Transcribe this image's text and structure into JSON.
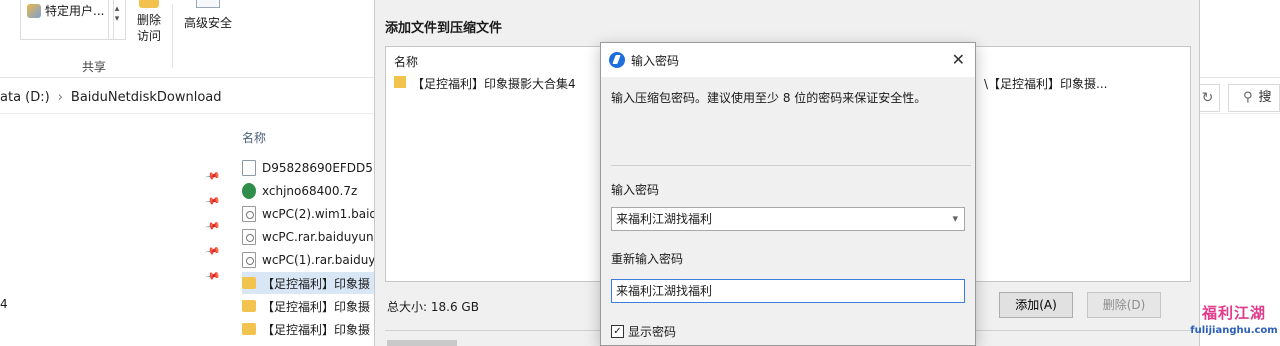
{
  "ribbon": {
    "share_dropdown": "特定用户...",
    "delete_access": [
      "删除",
      "访问"
    ],
    "advanced_security": "高级安全",
    "group_label": "共享"
  },
  "address": {
    "path": [
      "ata (D:)",
      "BaiduNetdiskDownload"
    ],
    "search_char": "搜"
  },
  "filelist": {
    "column_name": "名称",
    "items": [
      {
        "name": "D95828690EFDD5",
        "icon": "doc-icon"
      },
      {
        "name": "xchjno68400.7z",
        "icon": "7z-icon"
      },
      {
        "name": "wcPC(2).wim1.baid",
        "icon": "rar-icon"
      },
      {
        "name": "wcPC.rar.baiduyun",
        "icon": "rar-icon"
      },
      {
        "name": "wcPC(1).rar.baiduy",
        "icon": "rar-icon"
      },
      {
        "name": "【足控福利】印象摄",
        "icon": "folder-icon"
      },
      {
        "name": "【足控福利】印象摄",
        "icon": "folder-icon"
      },
      {
        "name": "【足控福利】印象摄",
        "icon": "folder-icon"
      }
    ],
    "left_fragment": "4"
  },
  "dialog": {
    "title": "添加文件到压缩文件",
    "list_header": "名称",
    "list_row": "【足控福利】印象摄影大合集4",
    "list_row_right": "\\【足控福利】印象摄...",
    "total_size": "总大小: 18.6 GB",
    "add_button": "添加(A)",
    "remove_button": "删除(D)"
  },
  "password_dialog": {
    "title": "输入密码",
    "description": "输入压缩包密码。建议使用至少 8 位的密码来保证安全性。",
    "label_password": "输入密码",
    "password_value": "来福利江湖找福利",
    "label_confirm": "重新输入密码",
    "confirm_value": "来福利江湖找福利",
    "show_password_label": "显示密码",
    "show_password_checked": "✓"
  },
  "watermark": {
    "line1": "福利江湖",
    "line2": "fulijianghu.com"
  }
}
